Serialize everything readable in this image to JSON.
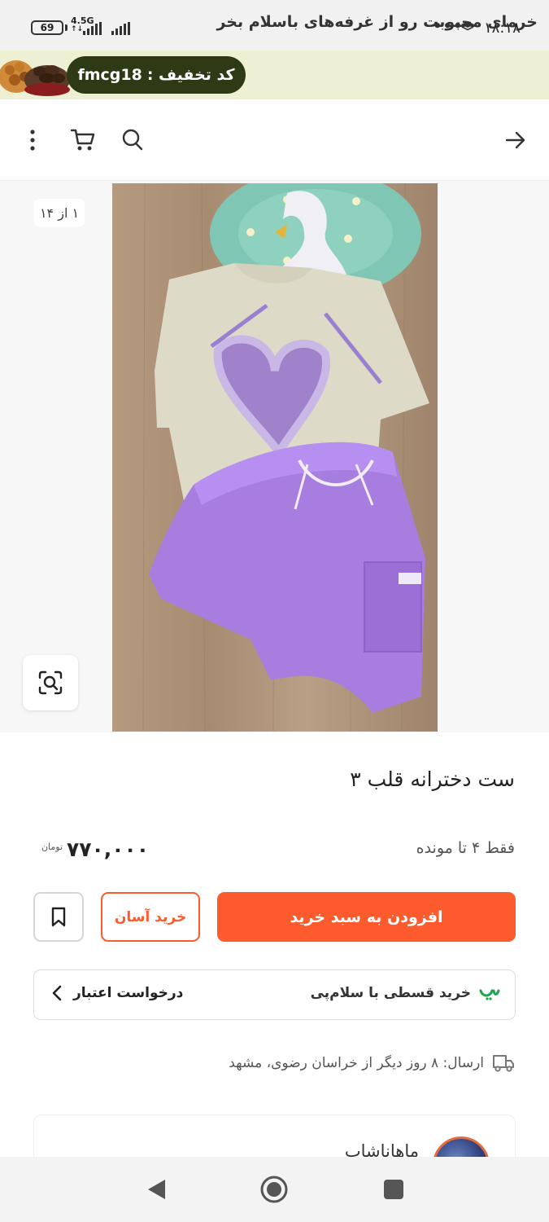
{
  "status_bar": {
    "battery": "69",
    "network": "4.5G",
    "network_sub": "↑↓",
    "time": "۱۸:۱۸",
    "dots": "•••",
    "icons": [
      "battery-icon",
      "signal-icon",
      "layers-icon"
    ]
  },
  "promo": {
    "text": "خرمای محبوبت رو از غرفه‌های باسلام بخر",
    "code_label": "کد تخفیف :",
    "code": "fmcg18",
    "colors": {
      "banner_bg": "#eef0d4",
      "pill_bg": "#2e3a16"
    }
  },
  "header": {
    "icons": [
      "back-arrow-icon",
      "search-icon",
      "cart-icon",
      "more-icon"
    ]
  },
  "gallery": {
    "counter": "۱ از ۱۴",
    "zoom_icon": "zoom-scan-icon"
  },
  "product": {
    "title": "ست دخترانه قلب ۳",
    "stock": "فقط ۴ تا مونده",
    "price": "۷۷۰,۰۰۰",
    "currency": "تومان"
  },
  "actions": {
    "add_to_cart": "افزودن به سبد خرید",
    "easy_buy": "خرید آسان",
    "bookmark_icon": "bookmark-icon",
    "accent_color": "#fd5b2d"
  },
  "credit": {
    "installment": "خرید قسطی با سلام‌پی",
    "request": "درخواست اعتبار",
    "brand_color": "#1fa34a"
  },
  "shipping": {
    "text": "ارسال: ۸ روز دیگر از خراسان رضوی، مشهد",
    "icon": "truck-icon"
  },
  "seller": {
    "name": "ماهاناشاپ"
  },
  "nav": {
    "icons": [
      "back-nav-icon",
      "home-nav-icon",
      "recents-nav-icon"
    ]
  }
}
